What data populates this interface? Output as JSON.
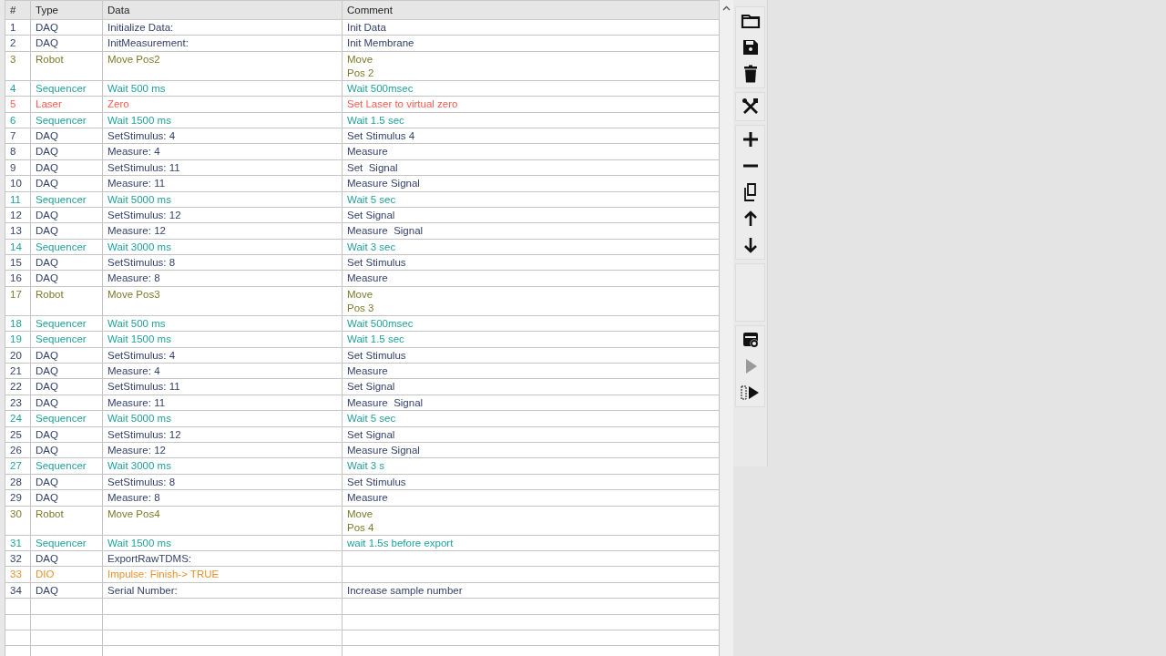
{
  "table": {
    "columns": [
      "#",
      "Type",
      "Data",
      "Comment"
    ],
    "rows": [
      {
        "num": "1",
        "type": "DAQ",
        "data": "Initialize Data:",
        "comment": "Init Data",
        "kind": "daq"
      },
      {
        "num": "2",
        "type": "DAQ",
        "data": "InitMeasurement:",
        "comment": "Init Membrane",
        "kind": "daq"
      },
      {
        "num": "3",
        "type": "Robot",
        "data": "Move Pos2",
        "comment": "Move\nPos 2",
        "kind": "robot"
      },
      {
        "num": "4",
        "type": "Sequencer",
        "data": "Wait 500 ms",
        "comment": "Wait 500msec",
        "kind": "sequencer"
      },
      {
        "num": "5",
        "type": "Laser",
        "data": "Zero",
        "comment": "Set Laser to virtual zero",
        "kind": "laser"
      },
      {
        "num": "6",
        "type": "Sequencer",
        "data": "Wait 1500 ms",
        "comment": "Wait 1.5 sec",
        "kind": "sequencer"
      },
      {
        "num": "7",
        "type": "DAQ",
        "data": "SetStimulus: 4",
        "comment": "Set Stimulus 4",
        "kind": "daq"
      },
      {
        "num": "8",
        "type": "DAQ",
        "data": "Measure: 4",
        "comment": "Measure",
        "kind": "daq"
      },
      {
        "num": "9",
        "type": "DAQ",
        "data": "SetStimulus: 11",
        "comment": "Set  Signal",
        "kind": "daq"
      },
      {
        "num": "10",
        "type": "DAQ",
        "data": "Measure: 11",
        "comment": "Measure Signal",
        "kind": "daq"
      },
      {
        "num": "11",
        "type": "Sequencer",
        "data": "Wait 5000 ms",
        "comment": "Wait 5 sec",
        "kind": "sequencer"
      },
      {
        "num": "12",
        "type": "DAQ",
        "data": "SetStimulus: 12",
        "comment": "Set Signal",
        "kind": "daq"
      },
      {
        "num": "13",
        "type": "DAQ",
        "data": "Measure: 12",
        "comment": "Measure  Signal",
        "kind": "daq"
      },
      {
        "num": "14",
        "type": "Sequencer",
        "data": "Wait 3000 ms",
        "comment": "Wait 3 sec",
        "kind": "sequencer"
      },
      {
        "num": "15",
        "type": "DAQ",
        "data": "SetStimulus: 8",
        "comment": "Set Stimulus",
        "kind": "daq"
      },
      {
        "num": "16",
        "type": "DAQ",
        "data": "Measure: 8",
        "comment": "Measure",
        "kind": "daq"
      },
      {
        "num": "17",
        "type": "Robot",
        "data": "Move Pos3",
        "comment": "Move\nPos 3",
        "kind": "robot"
      },
      {
        "num": "18",
        "type": "Sequencer",
        "data": "Wait 500 ms",
        "comment": "Wait 500msec",
        "kind": "sequencer"
      },
      {
        "num": "19",
        "type": "Sequencer",
        "data": "Wait 1500 ms",
        "comment": "Wait 1.5 sec",
        "kind": "sequencer"
      },
      {
        "num": "20",
        "type": "DAQ",
        "data": "SetStimulus: 4",
        "comment": "Set Stimulus",
        "kind": "daq"
      },
      {
        "num": "21",
        "type": "DAQ",
        "data": "Measure: 4",
        "comment": "Measure",
        "kind": "daq"
      },
      {
        "num": "22",
        "type": "DAQ",
        "data": "SetStimulus: 11",
        "comment": "Set Signal",
        "kind": "daq"
      },
      {
        "num": "23",
        "type": "DAQ",
        "data": "Measure: 11",
        "comment": "Measure  Signal",
        "kind": "daq"
      },
      {
        "num": "24",
        "type": "Sequencer",
        "data": "Wait 5000 ms",
        "comment": "Wait 5 sec",
        "kind": "sequencer"
      },
      {
        "num": "25",
        "type": "DAQ",
        "data": "SetStimulus: 12",
        "comment": "Set Signal",
        "kind": "daq"
      },
      {
        "num": "26",
        "type": "DAQ",
        "data": "Measure: 12",
        "comment": "Measure Signal",
        "kind": "daq"
      },
      {
        "num": "27",
        "type": "Sequencer",
        "data": "Wait 3000 ms",
        "comment": "Wait 3 s",
        "kind": "sequencer"
      },
      {
        "num": "28",
        "type": "DAQ",
        "data": "SetStimulus: 8",
        "comment": "Set Stimulus",
        "kind": "daq"
      },
      {
        "num": "29",
        "type": "DAQ",
        "data": "Measure: 8",
        "comment": "Measure",
        "kind": "daq"
      },
      {
        "num": "30",
        "type": "Robot",
        "data": "Move Pos4",
        "comment": "Move\nPos 4",
        "kind": "robot"
      },
      {
        "num": "31",
        "type": "Sequencer",
        "data": "Wait 1500 ms",
        "comment": "wait 1.5s before export",
        "kind": "sequencer"
      },
      {
        "num": "32",
        "type": "DAQ",
        "data": "ExportRawTDMS:",
        "kind": "daq"
      },
      {
        "num": "33",
        "type": "DIO",
        "data": "Impulse: Finish-> TRUE",
        "kind": "dio"
      },
      {
        "num": "34",
        "type": "DAQ",
        "data": "Serial Number:",
        "comment": "Increase sample number",
        "kind": "daq"
      }
    ]
  },
  "toolbar": {
    "groups": [
      {
        "kind": "buttons",
        "buttons": [
          {
            "kind": "folder",
            "disabled": false
          },
          {
            "kind": "save",
            "disabled": false
          },
          {
            "kind": "trash",
            "disabled": false
          }
        ]
      },
      {
        "kind": "buttons",
        "buttons": [
          {
            "kind": "tools",
            "disabled": false
          }
        ]
      },
      {
        "kind": "buttons",
        "buttons": [
          {
            "kind": "plus",
            "disabled": false
          },
          {
            "kind": "minus",
            "disabled": false
          },
          {
            "kind": "copy",
            "disabled": false
          },
          {
            "kind": "up",
            "disabled": false
          },
          {
            "kind": "down",
            "disabled": false
          }
        ]
      },
      {
        "kind": "spacer"
      },
      {
        "kind": "buttons",
        "buttons": [
          {
            "kind": "config",
            "disabled": false
          },
          {
            "kind": "play",
            "disabled": true
          },
          {
            "kind": "sequence",
            "disabled": false
          }
        ]
      }
    ]
  }
}
